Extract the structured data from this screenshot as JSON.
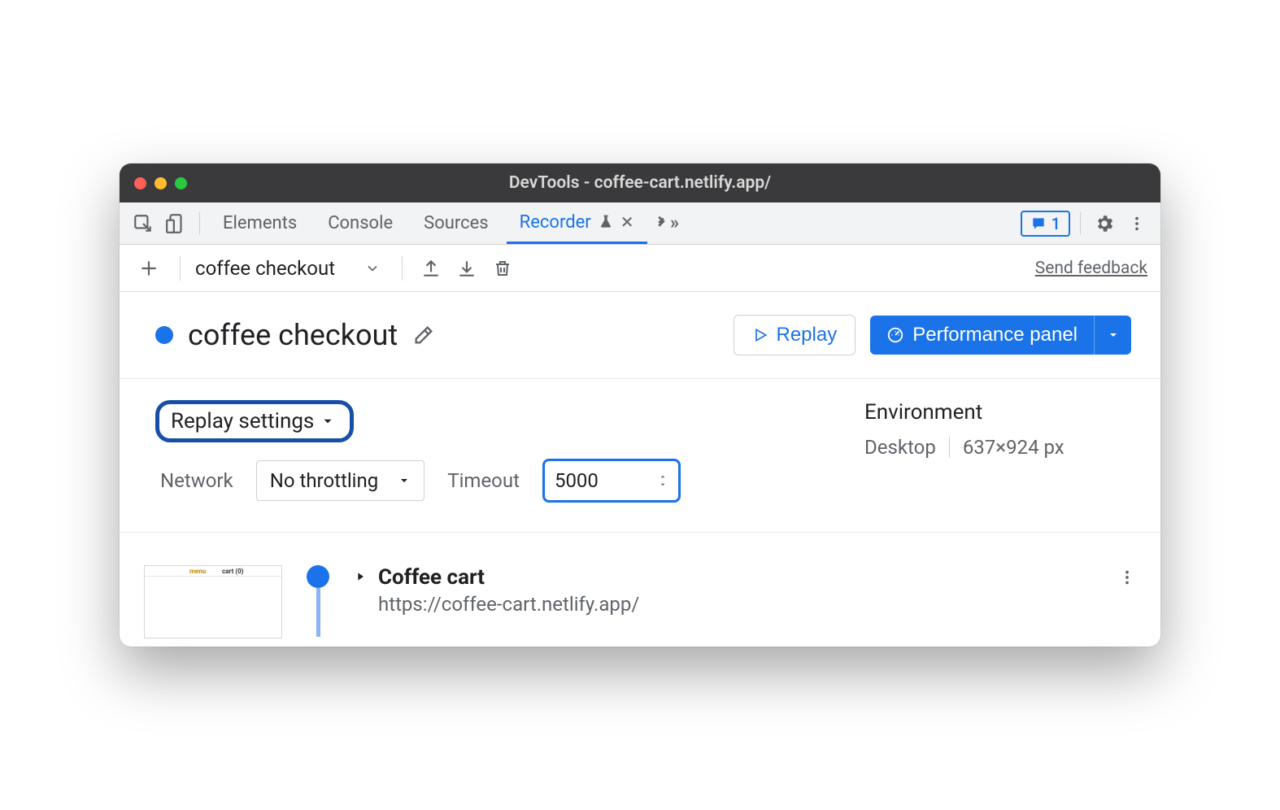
{
  "window": {
    "title": "DevTools - coffee-cart.netlify.app/"
  },
  "tabs": {
    "items": [
      "Elements",
      "Console",
      "Sources",
      "Recorder"
    ],
    "active": "Recorder",
    "issues_count": "1"
  },
  "toolbar": {
    "recording_name": "coffee checkout",
    "feedback": "Send feedback"
  },
  "header": {
    "title": "coffee checkout",
    "replay_label": "Replay",
    "perf_label": "Performance panel"
  },
  "settings": {
    "replay_settings_label": "Replay settings",
    "network_label": "Network",
    "throttling_value": "No throttling",
    "timeout_label": "Timeout",
    "timeout_value": "5000",
    "env_title": "Environment",
    "env_device": "Desktop",
    "env_viewport": "637×924 px"
  },
  "step": {
    "title": "Coffee cart",
    "url": "https://coffee-cart.netlify.app/"
  }
}
